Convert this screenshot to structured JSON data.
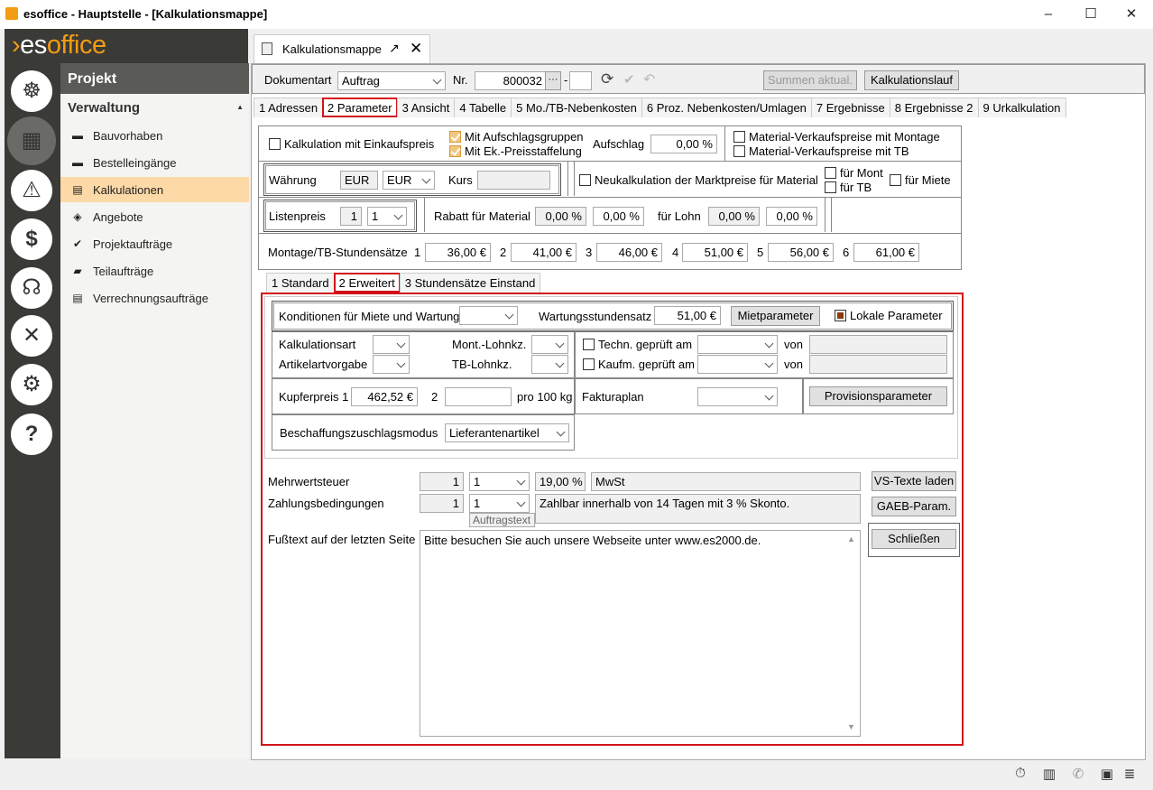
{
  "window": {
    "title": "esoffice - Hauptstelle - [Kalkulationsmappe]",
    "min": "–",
    "max": "☐",
    "close": "✕"
  },
  "brand": {
    "prefix": "es",
    "suffix": "office"
  },
  "rail": [
    {
      "icon": "helm-icon",
      "glyph": "☸"
    },
    {
      "icon": "calculator-icon",
      "glyph": "▦"
    },
    {
      "icon": "alarm-icon",
      "glyph": "⚠"
    },
    {
      "icon": "money-icon",
      "glyph": "$"
    },
    {
      "icon": "headset-icon",
      "glyph": "☊"
    },
    {
      "icon": "tools-icon",
      "glyph": "✕"
    },
    {
      "icon": "settings-icon",
      "glyph": "⚙"
    },
    {
      "icon": "help-icon",
      "glyph": "?"
    }
  ],
  "nav": {
    "header": "Projekt",
    "group": "Verwaltung",
    "group_arrow": "▲",
    "items": [
      {
        "label": "Bauvorhaben",
        "icon": "truck-icon",
        "glyph": "▬"
      },
      {
        "label": "Bestelleingänge",
        "icon": "truck-icon",
        "glyph": "▬"
      },
      {
        "label": "Kalkulationen",
        "icon": "calc-doc-icon",
        "glyph": "▤"
      },
      {
        "label": "Angebote",
        "icon": "tag-icon",
        "glyph": "◈"
      },
      {
        "label": "Projektaufträge",
        "icon": "check-circle-icon",
        "glyph": "✔"
      },
      {
        "label": "Teilaufträge",
        "icon": "cake-icon",
        "glyph": "▰"
      },
      {
        "label": "Verrechnungsaufträge",
        "icon": "doc-icon",
        "glyph": "▤"
      }
    ]
  },
  "doc_tab": {
    "label": "Kalkulationsmappe",
    "popout": "↗",
    "close": "✕"
  },
  "toolbar": {
    "doc_type_label": "Dokumentart",
    "doc_type_value": "Auftrag",
    "nr_label": "Nr.",
    "nr_value": "800032",
    "nr_more": "···",
    "dash": "-",
    "refresh": "⟳",
    "check": "✔",
    "undo": "↶",
    "btn_sum": "Summen aktual.",
    "btn_run": "Kalkulationslauf"
  },
  "main_tabs": [
    "1 Adressen",
    "2 Parameter",
    "3 Ansicht",
    "4 Tabelle",
    "5 Mo./TB-Nebenkosten",
    "6 Proz. Nebenkosten/Umlagen",
    "7 Ergebnisse",
    "8 Ergebnisse 2",
    "9 Urkalkulation"
  ],
  "params": {
    "kalk_ek": "Kalkulation mit Einkaufspreis",
    "aufschlagsgruppen": "Mit Aufschlagsgruppen",
    "ek_staffel": "Mit Ek.-Preisstaffelung",
    "aufschlag_label": "Aufschlag",
    "aufschlag_value": "0,00 %",
    "mat_vk_montage": "Material-Verkaufspreise mit Montage",
    "mat_vk_tb": "Material-Verkaufspreise mit TB",
    "waehrung_label": "Währung",
    "waehrung_code": "EUR",
    "waehrung_select": "EUR",
    "kurs_label": "Kurs",
    "kurs_value": "",
    "neukalk": "Neukalkulation der Marktpreise für Material",
    "fuer_mont": "für Mont",
    "fuer_tb": "für TB",
    "fuer_miete": "für Miete",
    "listenpreis_label": "Listenpreis",
    "listenpreis_num": "1",
    "listenpreis_sel": "1",
    "rabatt_mat_label": "Rabatt für Material",
    "rabatt_mat_1": "0,00 %",
    "rabatt_mat_2": "0,00 %",
    "lohn_label": "für Lohn",
    "lohn_1": "0,00 %",
    "lohn_2": "0,00 %",
    "stundensaetze_label": "Montage/TB-Stundensätze",
    "rates": [
      {
        "n": "1",
        "v": "36,00 €"
      },
      {
        "n": "2",
        "v": "41,00 €"
      },
      {
        "n": "3",
        "v": "46,00 €"
      },
      {
        "n": "4",
        "v": "51,00 €"
      },
      {
        "n": "5",
        "v": "56,00 €"
      },
      {
        "n": "6",
        "v": "61,00 €"
      }
    ]
  },
  "sub_tabs": [
    "1 Standard",
    "2 Erweitert",
    "3 Stundensätze Einstand"
  ],
  "erweitert": {
    "kond_label": "Konditionen für Miete und Wartung",
    "kond_value": "",
    "wartung_label": "Wartungsstundensatz",
    "wartung_value": "51,00 €",
    "mietparameter": "Mietparameter",
    "lokale": "Lokale Parameter",
    "kalkart_label": "Kalkulationsart",
    "artvorgabe_label": "Artikelartvorgabe",
    "mont_lohnkz_label": "Mont.-Lohnkz.",
    "tb_lohnkz_label": "TB-Lohnkz.",
    "techn_label": "Techn. geprüft am",
    "kaufm_label": "Kaufm. geprüft am",
    "von": "von",
    "kupfer_label": "Kupferpreis 1",
    "kupfer_1": "462,52 €",
    "kupfer_2_label": "2",
    "kupfer_2": "",
    "pro_kg": "pro 100 kg",
    "fakturaplan_label": "Fakturaplan",
    "provision": "Provisionsparameter",
    "beschaffung_label": "Beschaffungszuschlagsmodus",
    "beschaffung_value": "Lieferantenartikel"
  },
  "bottom": {
    "mwst_label": "Mehrwertsteuer",
    "mwst_num": "1",
    "mwst_sel": "1",
    "mwst_pct": "19,00 %",
    "mwst_name": "MwSt",
    "zahl_label": "Zahlungsbedingungen",
    "zahl_num": "1",
    "zahl_sel": "1",
    "zahl_text": "Zahlbar innerhalb von 14 Tagen mit 3 % Skonto.",
    "auftragstext": "Auftragstext",
    "fuss_label": "Fußtext auf der letzten Seite",
    "fuss_text": "Bitte besuchen Sie auch unsere Webseite unter www.es2000.de.",
    "btn_vs": "VS-Texte laden",
    "btn_gaeb": "GAEB-Param.",
    "btn_close": "Schließen"
  },
  "status_icons": [
    "stopwatch-icon",
    "building-icon",
    "phone-icon",
    "lock-icon",
    "database-icon"
  ],
  "colors": {
    "accent": "#f39c12",
    "highlight_red": "#d1121b",
    "nav_selected": "#fcd9a6",
    "rail": "#3a3a37"
  }
}
